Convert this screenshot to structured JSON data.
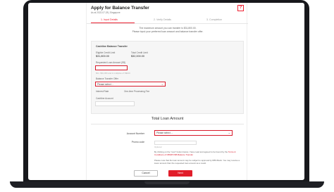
{
  "header": {
    "title": "Apply for Balance Transfer",
    "subtitle": "As at 2022-07-28 | Singapore",
    "help": "?"
  },
  "steps": [
    "1. Input Details",
    "2. Verify Details",
    "3. Completion"
  ],
  "notice": [
    "The maximum amount you can transfer is $31,800.00.",
    "Please input your preferred loan amount and balance transfer offer."
  ],
  "card": {
    "title": "Cashline Balance Transfer",
    "eligible_label": "Eligible Credit Limit",
    "eligible_value": "$31,800.00",
    "total_label": "Total Credit Limit",
    "total_value": "$32,000.00",
    "loan_label": "Requested Loan Amount (S$)",
    "loan_value": "",
    "loan_hint": "Min. S$1,000 and in multiples of S$100",
    "offer_label": "Balance Transfer Offer",
    "offer_value": "Please select ...",
    "rate_label": "Interest Rate",
    "fee_label": "One-time Processing Fee",
    "cashline_label": "Cashline Account"
  },
  "section_title": "Total Loan Amount",
  "account": {
    "label": "Account Number",
    "value": "Please select ...",
    "promo_label": "Promo code",
    "promo_hint": "Optional"
  },
  "terms": {
    "text1": "By clicking on the \"next\" button below, I have read and agreed to be bound by the",
    "link": "Terms & Conditions of DBS/POSB Balance Transfer",
    "text2": "Please note that the loan amount may be subject to approval by DBS Bank. You may receive a lower amount than the requested loan amount as a result."
  },
  "buttons": {
    "cancel": "Cancel",
    "next": "Next"
  },
  "colors": {
    "accent": "#e11d2a",
    "highlight": "#d81a2b",
    "bezel": "#17181c"
  }
}
